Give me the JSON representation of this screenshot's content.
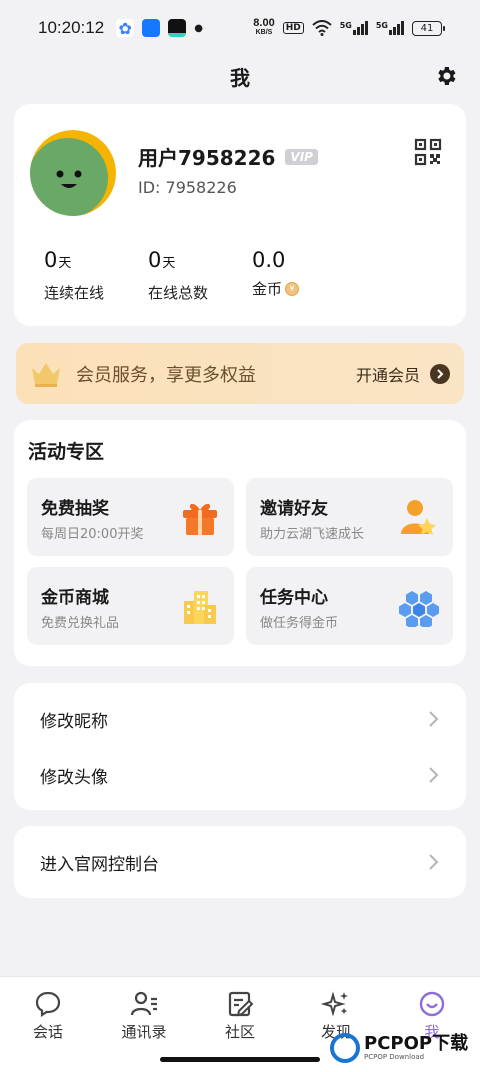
{
  "status_bar": {
    "time": "10:20:12",
    "net_speed_value": "8.00",
    "net_speed_unit": "KB/S",
    "hd": "HD",
    "signal1": "5G",
    "signal2": "5G",
    "battery": "41"
  },
  "header": {
    "title": "我"
  },
  "profile": {
    "name": "用户7958226",
    "vip": "VIP",
    "id_label": "ID: 7958226",
    "stats": [
      {
        "value": "0",
        "unit": "天",
        "label": "连续在线"
      },
      {
        "value": "0",
        "unit": "天",
        "label": "在线总数"
      },
      {
        "value": "0.0",
        "unit": "",
        "label": "金币"
      }
    ]
  },
  "member": {
    "text": "会员服务，享更多权益",
    "action": "开通会员"
  },
  "activity": {
    "title": "活动专区",
    "tiles": [
      {
        "title": "免费抽奖",
        "sub": "每周日20:00开奖",
        "icon": "gift-icon"
      },
      {
        "title": "邀请好友",
        "sub": "助力云湖飞速成长",
        "icon": "invite-icon"
      },
      {
        "title": "金币商城",
        "sub": "免费兑换礼品",
        "icon": "store-icon"
      },
      {
        "title": "任务中心",
        "sub": "做任务得金币",
        "icon": "hexagon-icon"
      }
    ]
  },
  "settings_list": [
    {
      "label": "修改昵称"
    },
    {
      "label": "修改头像"
    }
  ],
  "console": {
    "label": "进入官网控制台"
  },
  "tabs": [
    {
      "label": "会话",
      "icon": "chat-icon"
    },
    {
      "label": "通讯录",
      "icon": "contacts-icon"
    },
    {
      "label": "社区",
      "icon": "community-icon"
    },
    {
      "label": "发现",
      "icon": "discover-icon"
    },
    {
      "label": "我",
      "icon": "me-icon"
    }
  ],
  "watermark": {
    "main": "PCPOP下载",
    "sub": "PCPOP Download"
  },
  "colors": {
    "accent": "#8e6cdb",
    "banner": "#fbe1b8",
    "background": "#f2f2f4"
  }
}
